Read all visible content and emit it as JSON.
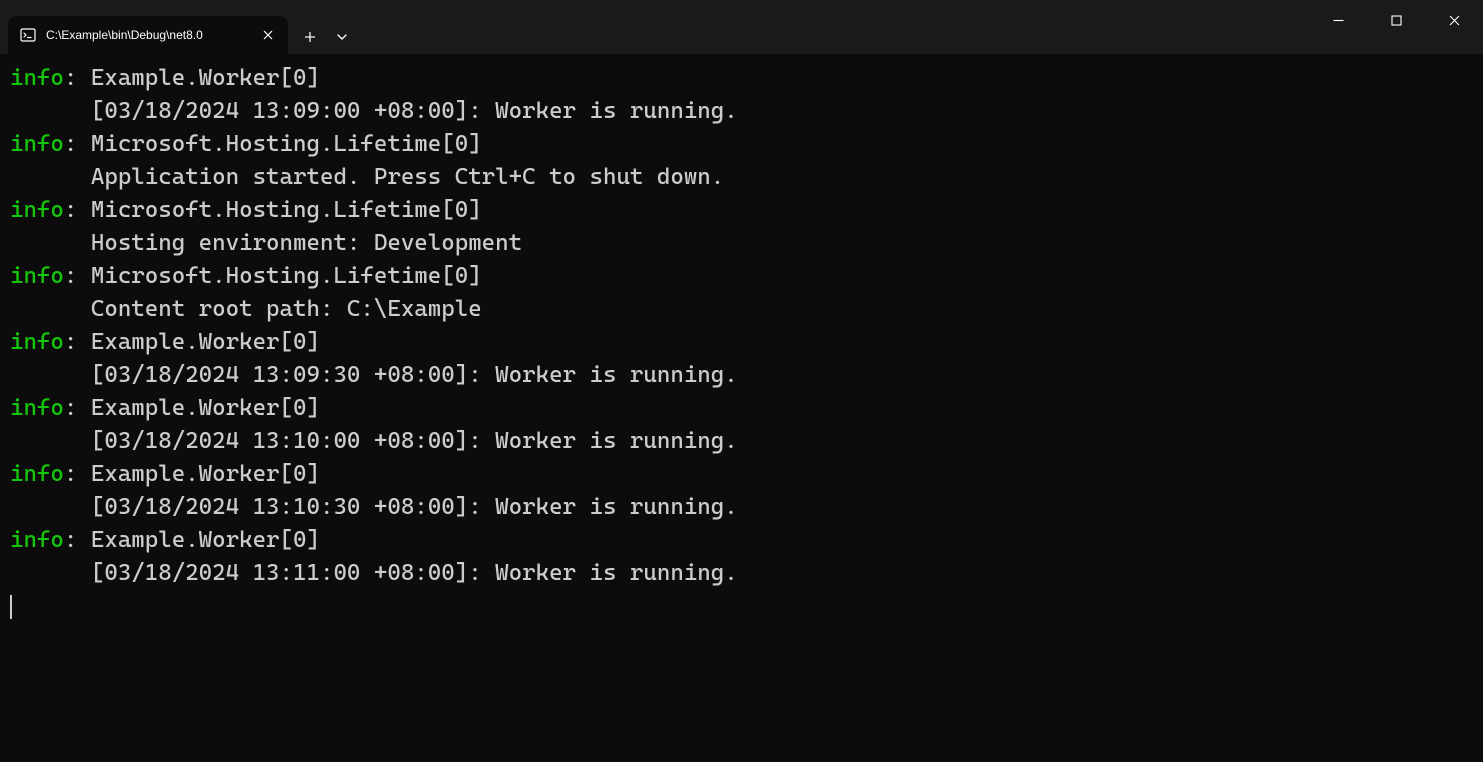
{
  "titlebar": {
    "tab": {
      "title": "C:\\Example\\bin\\Debug\\net8.0"
    }
  },
  "log": {
    "level_label": "info",
    "separator": ": ",
    "indent": "      ",
    "entries": [
      {
        "source": "Example.Worker[0]",
        "message": "[03/18/2024 13:09:00 +08:00]: Worker is running."
      },
      {
        "source": "Microsoft.Hosting.Lifetime[0]",
        "message": "Application started. Press Ctrl+C to shut down."
      },
      {
        "source": "Microsoft.Hosting.Lifetime[0]",
        "message": "Hosting environment: Development"
      },
      {
        "source": "Microsoft.Hosting.Lifetime[0]",
        "message": "Content root path: C:\\Example"
      },
      {
        "source": "Example.Worker[0]",
        "message": "[03/18/2024 13:09:30 +08:00]: Worker is running."
      },
      {
        "source": "Example.Worker[0]",
        "message": "[03/18/2024 13:10:00 +08:00]: Worker is running."
      },
      {
        "source": "Example.Worker[0]",
        "message": "[03/18/2024 13:10:30 +08:00]: Worker is running."
      },
      {
        "source": "Example.Worker[0]",
        "message": "[03/18/2024 13:11:00 +08:00]: Worker is running."
      }
    ]
  }
}
